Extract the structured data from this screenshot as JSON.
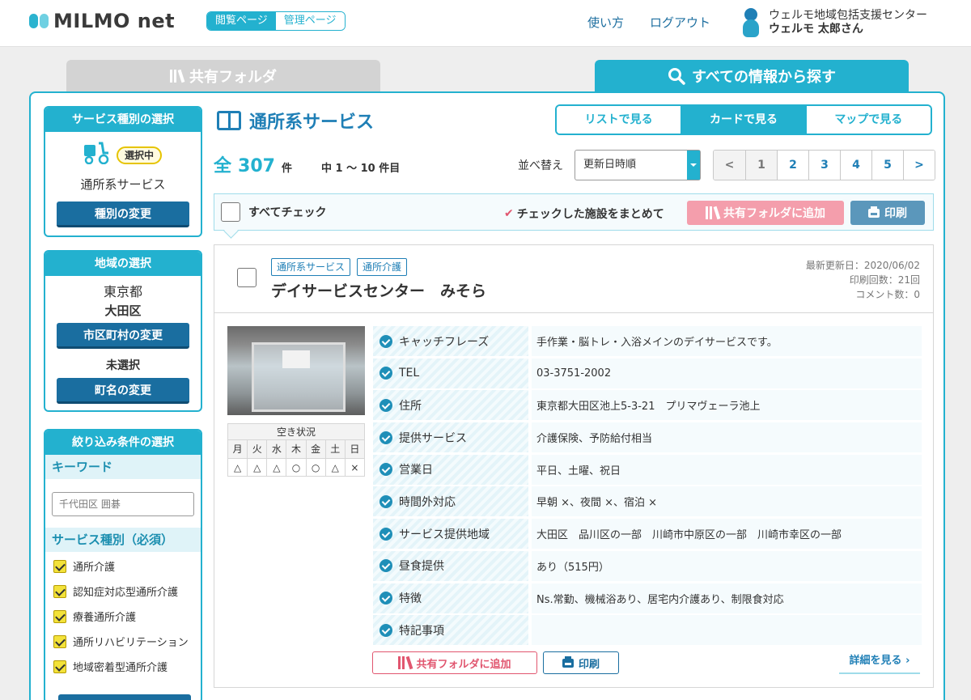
{
  "header": {
    "logo_text": "MILMO net",
    "mode_view": "閲覧ページ",
    "mode_admin": "管理ページ",
    "nav_help": "使い方",
    "nav_logout": "ログアウト",
    "user_org": "ウェルモ地域包括支援センター",
    "user_name": "ウェルモ 太郎さん"
  },
  "tabs": {
    "shared_folder": "共有フォルダ",
    "search_all": "すべての情報から探す"
  },
  "sidebar": {
    "service_type": {
      "title": "サービス種別の選択",
      "badge": "選択中",
      "selected": "通所系サービス",
      "change_button": "種別の変更"
    },
    "region": {
      "title": "地域の選択",
      "prefecture": "東京都",
      "city": "大田区",
      "city_button": "市区町村の変更",
      "town": "未選択",
      "town_button": "町名の変更"
    },
    "filters": {
      "title": "絞り込み条件の選択",
      "keyword_label": "キーワード",
      "keyword_placeholder": "千代田区 囲碁",
      "service_label": "サービス種別（必須）",
      "services": [
        "通所介護",
        "認知症対応型通所介護",
        "療養通所介護",
        "通所リハビリテーション",
        "地域密着型通所介護"
      ]
    }
  },
  "content": {
    "title": "通所系サービス",
    "views": [
      "リストで見る",
      "カードで見る",
      "マップで見る"
    ],
    "count_prefix": "全",
    "count": "307",
    "count_suffix": "件",
    "range": "中 1 ～ 10 件目",
    "sort_label": "並べ替え",
    "sort_value": "更新日時順",
    "pages": [
      "<",
      "1",
      "2",
      "3",
      "4",
      "5",
      ">"
    ],
    "check_all": "すべてチェック",
    "bulk_label": "チェックした施設をまとめて",
    "add_shared": "共有フォルダに追加",
    "print": "印刷"
  },
  "facility": {
    "tags": [
      "通所系サービス",
      "通所介護"
    ],
    "name": "デイサービスセンター　みそら",
    "updated": "最新更新日：2020/06/02",
    "print_count": "印刷回数：21回",
    "comment_count": "コメント数：0",
    "availability": {
      "title": "空き状況",
      "days": [
        "月",
        "火",
        "水",
        "木",
        "金",
        "土",
        "日"
      ],
      "values": [
        "△",
        "△",
        "△",
        "○",
        "○",
        "△",
        "×"
      ]
    },
    "info": [
      {
        "label": "キャッチフレーズ",
        "value": "手作業・脳トレ・入浴メインのデイサービスです。"
      },
      {
        "label": "TEL",
        "value": "03-3751-2002"
      },
      {
        "label": "住所",
        "value": "東京都大田区池上5-3-21　プリマヴェーラ池上"
      },
      {
        "label": "提供サービス",
        "value": "介護保険、予防給付相当"
      },
      {
        "label": "営業日",
        "value": "平日、土曜、祝日"
      },
      {
        "label": "時間外対応",
        "value": "早朝 ×、夜間 ×、宿泊 ×"
      },
      {
        "label": "サービス提供地域",
        "value": "大田区　品川区の一部　川崎市中原区の一部　川崎市幸区の一部"
      },
      {
        "label": "昼食提供",
        "value": "あり（515円）"
      },
      {
        "label": "特徴",
        "value": "Ns.常勤、機械浴あり、居宅内介護あり、制限食対応"
      },
      {
        "label": "特記事項",
        "value": ""
      }
    ],
    "add_shared": "共有フォルダに追加",
    "print": "印刷",
    "detail_link": "詳細を見る ›"
  }
}
